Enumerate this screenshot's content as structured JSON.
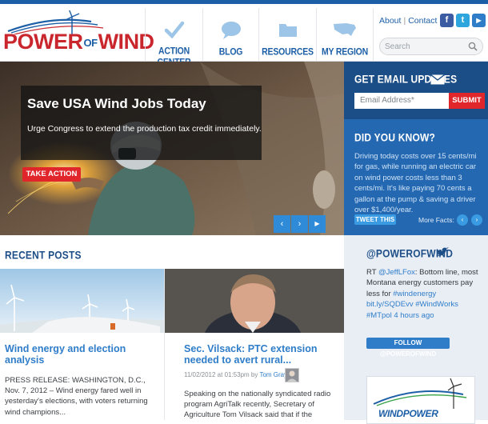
{
  "brand": {
    "logo_main": "POWER",
    "logo_of": "OF",
    "logo_end": "WIND"
  },
  "nav": [
    {
      "label": "ACTION CENTER",
      "icon": "check-icon"
    },
    {
      "label": "BLOG",
      "icon": "speech-bubble-icon"
    },
    {
      "label": "RESOURCES",
      "icon": "folder-icon"
    },
    {
      "label": "MY REGION",
      "icon": "usa-map-icon"
    }
  ],
  "utility": {
    "about": "About",
    "contact": "Contact",
    "separator": "|"
  },
  "social": {
    "facebook": "f",
    "twitter": "t",
    "youtube": "▶"
  },
  "search": {
    "placeholder": "Search"
  },
  "hero": {
    "title": "Save USA Wind Jobs Today",
    "subtitle": "Urge Congress to extend the production tax credit immediately.",
    "cta": "TAKE ACTION",
    "prev": "‹",
    "next": "›",
    "play": "▶"
  },
  "email_signup": {
    "heading": "GET EMAIL UPDATES",
    "placeholder": "Email Address*",
    "submit": "SUBMIT"
  },
  "did_you_know": {
    "heading": "DID YOU KNOW?",
    "text": "Driving today costs over 15 cents/mi for gas, while running an electric car on wind power costs less than 3 cents/mi. It's like paying 70 cents a gallon at the pump & saving a driver over $1,400/year.",
    "tweet": "TWEET THIS",
    "more": "More Facts:"
  },
  "twitter": {
    "heading": "@POWEROFWIND",
    "tweet_prefix": "RT ",
    "tweet_handle": "@JeffLFox",
    "tweet_body": ": Bottom line, most Montana energy customers pay less for ",
    "tweet_tag": "#windenergy",
    "tweet_link": "bit.ly/SQDEvv",
    "tweet_tag2": "#WindWorks",
    "tweet_tag3": "#MTpol",
    "tweet_time": "4 hours ago",
    "follow": "FOLLOW @POWEROFWIND",
    "ad_text": "WINDPOWER"
  },
  "recent": {
    "heading": "RECENT POSTS",
    "posts": [
      {
        "title": "Wind energy and election analysis",
        "excerpt": "PRESS RELEASE: WASHINGTON, D.C., Nov. 7, 2012 – Wind energy fared well in yesterday's elections, with voters returning wind champions..."
      },
      {
        "title": "Sec. Vilsack: PTC extension needed to avert rural...",
        "date": "11/02/2012 at 01:53pm by ",
        "author": "Tom Gray",
        "excerpt": "Speaking on the nationally syndicated radio program AgriTalk recently, Secretary of Agriculture Tom Vilsack said that if the"
      }
    ]
  },
  "colors": {
    "brand_red": "#c9272d",
    "brand_blue": "#1d5fa6",
    "accent_red": "#e0262b",
    "sidebar_blue": "#2468b1"
  }
}
